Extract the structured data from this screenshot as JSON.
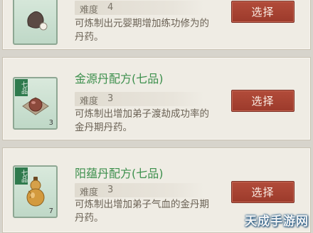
{
  "recipes": [
    {
      "title": "",
      "grade": "",
      "difficulty_label": "难度",
      "difficulty_value": "4",
      "desc_line1": "可炼制出元婴期增加练功修为的",
      "desc_line2": "丹药。",
      "select_label": "选择",
      "icon": "dark-pill-pouch-icon",
      "quantity": ""
    },
    {
      "title": "金源丹配方(七品)",
      "grade": "七品",
      "difficulty_label": "难度",
      "difficulty_value": "3",
      "desc_line1": "可炼制出增加弟子渡劫成功率的",
      "desc_line2": "金丹期丹药。",
      "select_label": "选择",
      "icon": "pill-on-plate-icon",
      "quantity": "3"
    },
    {
      "title": "阳蕴丹配方(七品)",
      "grade": "七品",
      "difficulty_label": "难度",
      "difficulty_value": "3",
      "desc_line1": "可炼制出增加弟子气血的金丹期",
      "desc_line2": "丹药。",
      "select_label": "选择",
      "icon": "gourd-icon",
      "quantity": "7"
    }
  ],
  "watermark": "天成手游网",
  "colors": {
    "title_green": "#3c8f4c",
    "button_red": "#a84434",
    "card_bg": "#efece4",
    "thumb_green": "#bfd8c7"
  }
}
